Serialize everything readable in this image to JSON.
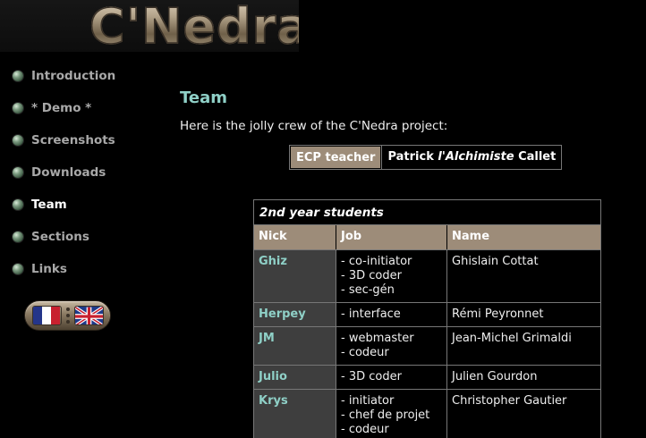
{
  "logo": {
    "text": "C'Nedra"
  },
  "nav": {
    "items": [
      {
        "label": "Introduction",
        "active": false
      },
      {
        "label": "* Demo *",
        "active": false
      },
      {
        "label": "Screenshots",
        "active": false
      },
      {
        "label": "Downloads",
        "active": false
      },
      {
        "label": "Team",
        "active": true
      },
      {
        "label": "Sections",
        "active": false
      },
      {
        "label": "Links",
        "active": false
      }
    ],
    "language_toggle": {
      "flags": [
        "flag-fr-icon",
        "flag-uk-icon"
      ]
    }
  },
  "main": {
    "title": "Team",
    "intro": "Here is the jolly crew of the C'Nedra project:",
    "teacher": {
      "label": "ECP teacher",
      "first": "Patrick",
      "alias": "l'Alchimiste",
      "last": "Callet"
    },
    "students": {
      "caption": "2nd year students",
      "headers": {
        "nick": "Nick",
        "job": "Job",
        "name": "Name"
      },
      "rows": [
        {
          "nick": "Ghiz",
          "job": [
            "- co-initiator",
            "- 3D coder",
            "- sec-gén"
          ],
          "name": "Ghislain Cottat"
        },
        {
          "nick": "Herpey",
          "job": [
            "- interface"
          ],
          "name": "Rémi Peyronnet"
        },
        {
          "nick": "JM",
          "job": [
            "- webmaster",
            "- codeur"
          ],
          "name": "Jean-Michel Grimaldi"
        },
        {
          "nick": "Julio",
          "job": [
            "- 3D coder"
          ],
          "name": "Julien Gourdon"
        },
        {
          "nick": "Krys",
          "job": [
            "- initiator",
            "- chef de projet",
            "- codeur"
          ],
          "name": "Christopher Gautier"
        }
      ]
    }
  },
  "colors": {
    "background": "#000000",
    "accent_teal": "#8fd0c7",
    "header_tan": "#9d8c79",
    "nick_cell": "#3e3e3e"
  }
}
